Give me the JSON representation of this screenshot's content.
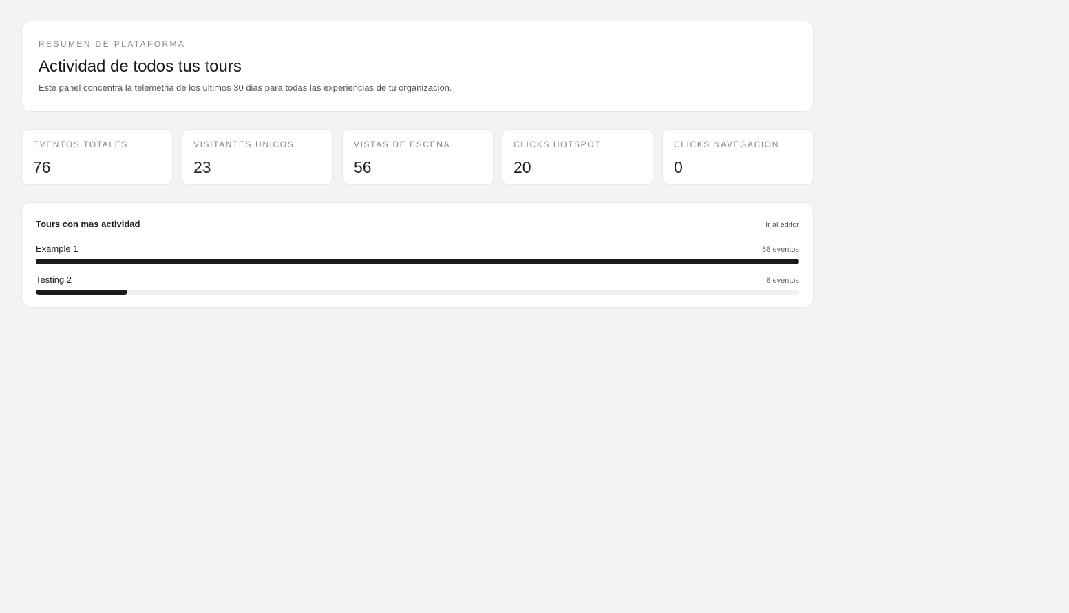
{
  "summary": {
    "eyebrow": "RESUMEN DE PLATAFORMA",
    "title": "Actividad de todos tus tours",
    "description": "Este panel concentra la telemetria de los ultimos 30 dias para todas las experiencias de tu organizacion."
  },
  "stats": [
    {
      "label": "EVENTOS TOTALES",
      "value": "76"
    },
    {
      "label": "VISITANTES UNICOS",
      "value": "23"
    },
    {
      "label": "VISTAS DE ESCENA",
      "value": "56"
    },
    {
      "label": "CLICKS HOTSPOT",
      "value": "20"
    },
    {
      "label": "CLICKS NAVEGACION",
      "value": "0"
    }
  ],
  "tours_panel": {
    "title": "Tours con mas actividad",
    "link_label": "Ir al editor",
    "items": [
      {
        "name": "Example 1",
        "count_label": "68 eventos",
        "events": 68,
        "fill_fraction": 1.0
      },
      {
        "name": "Testing 2",
        "count_label": "8 eventos",
        "events": 8,
        "fill_fraction": 0.12
      }
    ]
  },
  "colors": {
    "background": "#f3f3f3",
    "card": "#ffffff",
    "bar_fill": "#1a1a1a",
    "bar_track": "#f0f0f0"
  }
}
